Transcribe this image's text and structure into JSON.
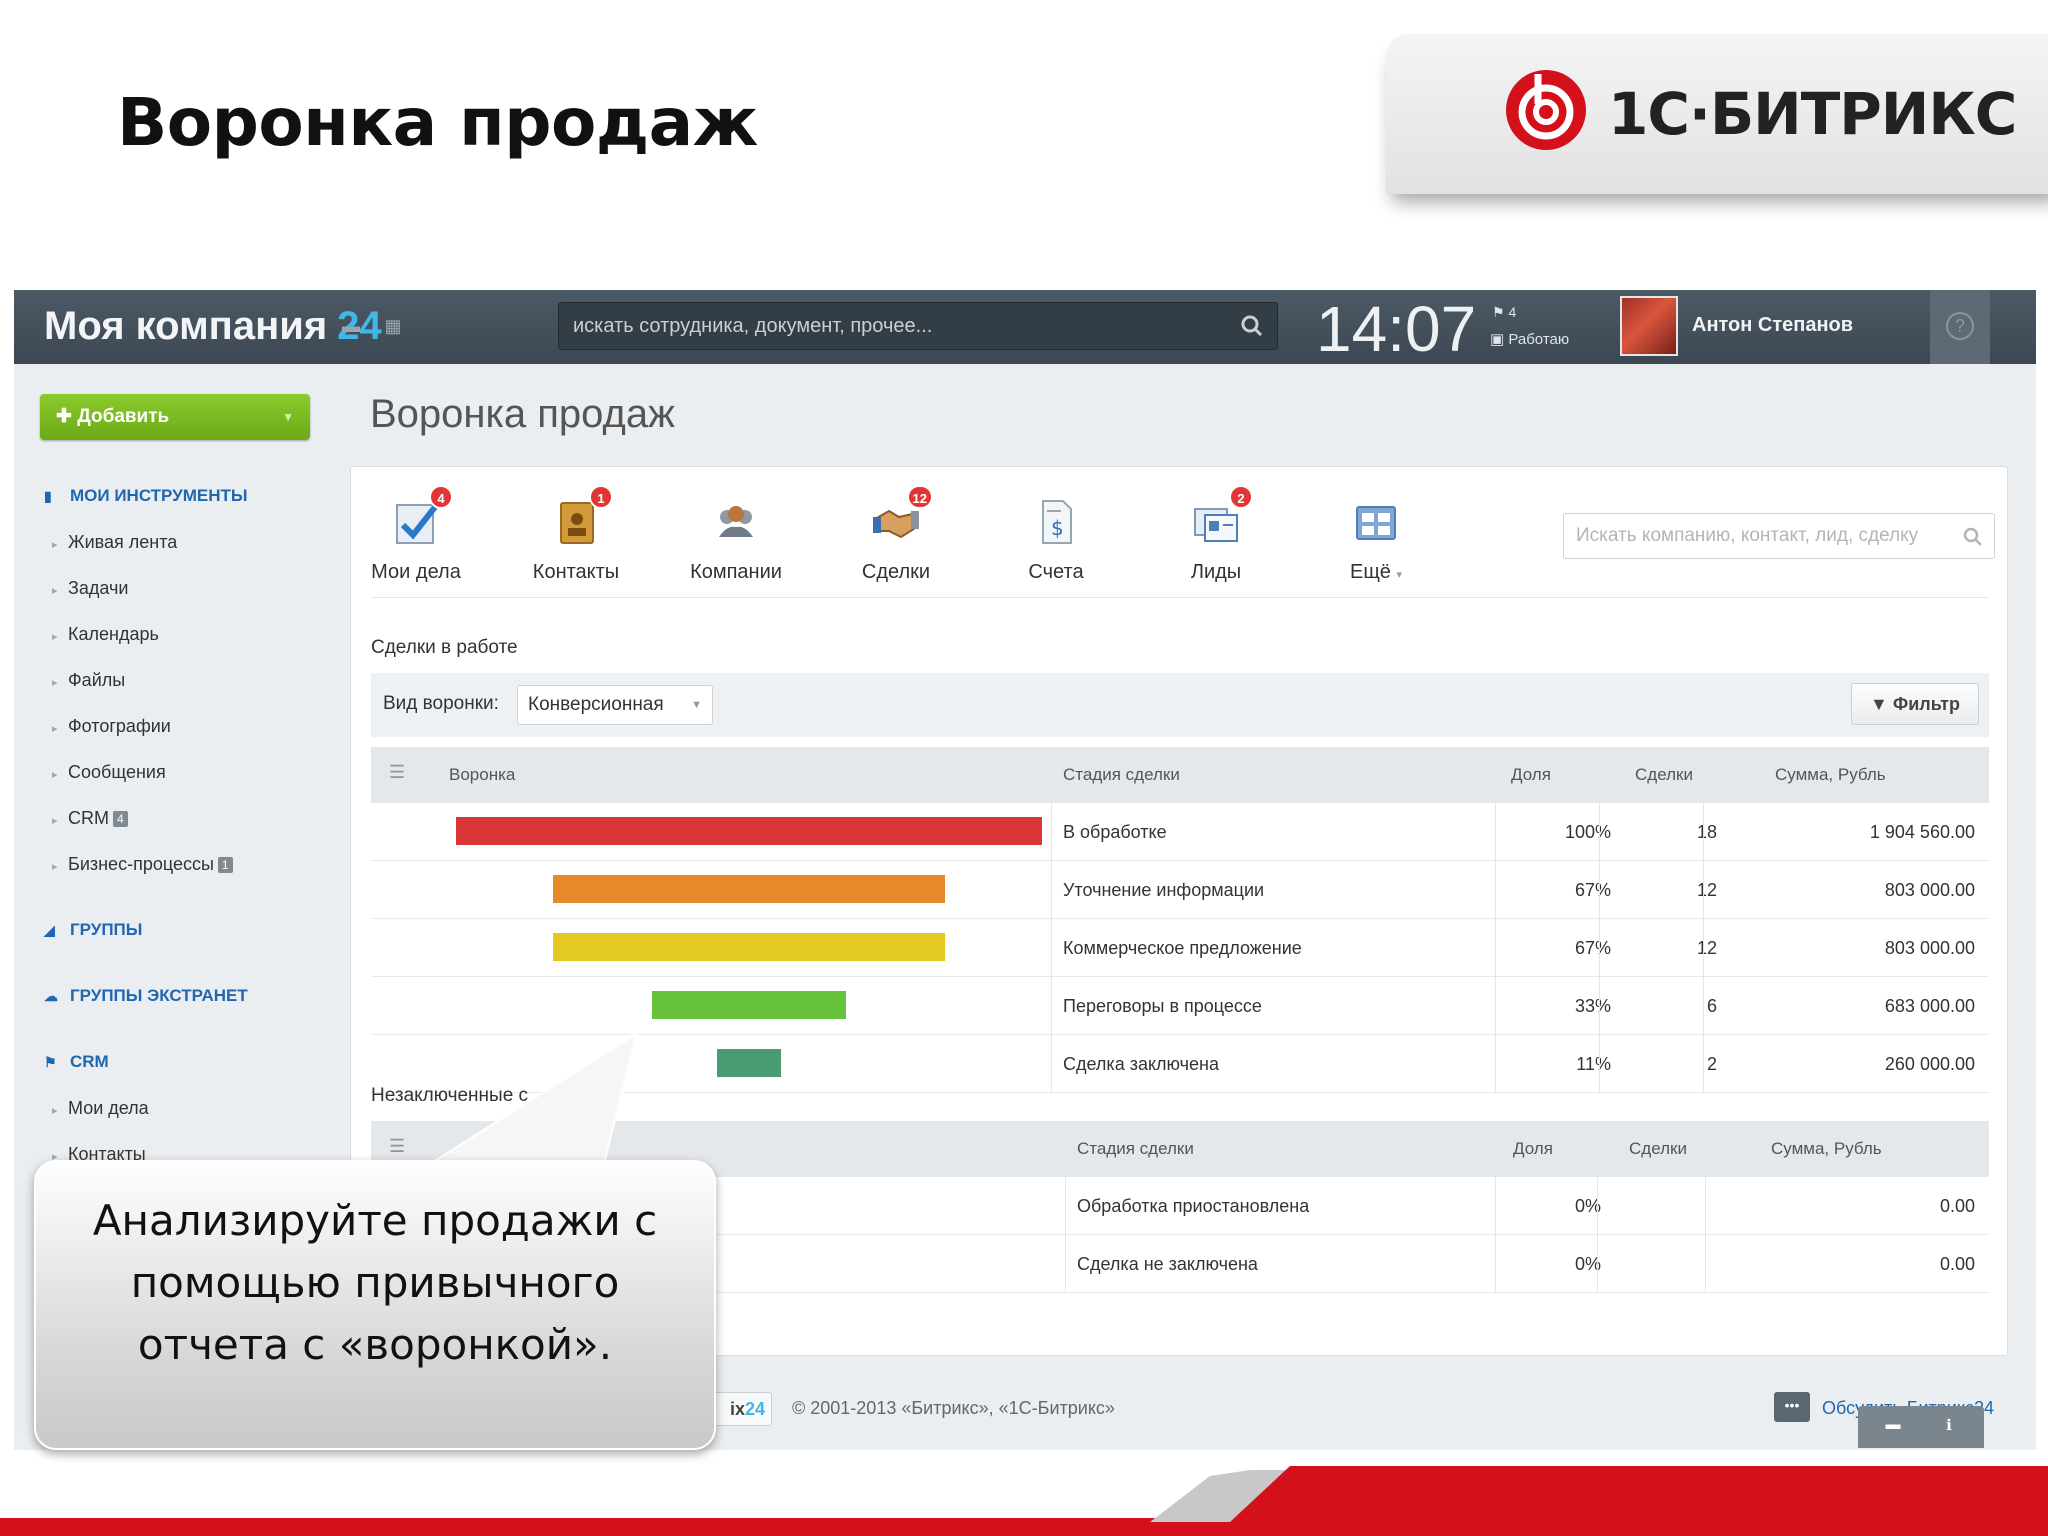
{
  "slide": {
    "title": "Воронка продаж",
    "logo_text": "1С·БИТРИКС"
  },
  "topbar": {
    "brand": "Моя компания",
    "brand_num": "24",
    "search_placeholder": "искать сотрудника, документ, прочее...",
    "clock": "14:07",
    "flag_count": "4",
    "status": "Работаю",
    "user_name": "Антон Степанов",
    "help": "?"
  },
  "sidebar": {
    "add_label": "Добавить",
    "my_tools": "МОИ ИНСТРУМЕНТЫ",
    "items": [
      {
        "label": "Живая лента"
      },
      {
        "label": "Задачи"
      },
      {
        "label": "Календарь"
      },
      {
        "label": "Файлы"
      },
      {
        "label": "Фотографии"
      },
      {
        "label": "Сообщения"
      },
      {
        "label": "CRM",
        "count": "4"
      },
      {
        "label": "Бизнес-процессы",
        "count": "1"
      }
    ],
    "groups": "ГРУППЫ",
    "extranet": "ГРУППЫ ЭКСТРАНЕТ",
    "crm": "CRM",
    "crm_items": [
      {
        "label": "Мои дела"
      },
      {
        "label": "Контакты"
      }
    ]
  },
  "main": {
    "page_title": "Воронка продаж",
    "tools": [
      {
        "label": "Мои дела",
        "badge": "4",
        "icon": "checklist-icon"
      },
      {
        "label": "Контакты",
        "badge": "1",
        "icon": "contacts-book-icon"
      },
      {
        "label": "Компании",
        "badge": "",
        "icon": "people-group-icon"
      },
      {
        "label": "Сделки",
        "badge": "12",
        "icon": "handshake-icon"
      },
      {
        "label": "Счета",
        "badge": "",
        "icon": "invoice-icon"
      },
      {
        "label": "Лиды",
        "badge": "2",
        "icon": "lead-cards-icon"
      },
      {
        "label": "Ещё",
        "badge": "",
        "icon": "more-grid-icon"
      }
    ],
    "crm_search_placeholder": "Искать компанию, контакт, лид, сделку",
    "in_work_label": "Сделки в работе",
    "funnel_type_label": "Вид воронки:",
    "funnel_type_value": "Конверсионная",
    "filter_label": "Фильтр",
    "columns": {
      "funnel": "Воронка",
      "stage": "Стадия сделки",
      "share": "Доля",
      "deals": "Сделки",
      "sum": "Сумма, Рубль"
    },
    "funnel_rows": [
      {
        "stage": "В обработке",
        "share": "100%",
        "deals": "18",
        "sum": "1 904 560.00",
        "color": "#d93636",
        "fraction": 1.0
      },
      {
        "stage": "Уточнение информации",
        "share": "67%",
        "deals": "12",
        "sum": "803 000.00",
        "color": "#e5892b",
        "fraction": 0.67
      },
      {
        "stage": "Коммерческое предложение",
        "share": "67%",
        "deals": "12",
        "sum": "803 000.00",
        "color": "#e5c923",
        "fraction": 0.67
      },
      {
        "stage": "Переговоры в процессе",
        "share": "33%",
        "deals": "6",
        "sum": "683 000.00",
        "color": "#66c23a",
        "fraction": 0.33
      },
      {
        "stage": "Сделка заключена",
        "share": "11%",
        "deals": "2",
        "sum": "260 000.00",
        "color": "#4a9a72",
        "fraction": 0.11
      }
    ],
    "lost_label": "Незаключенные с",
    "lost_rows": [
      {
        "stage": "Обработка приостановлена",
        "share": "0%",
        "deals": "",
        "sum": "0.00"
      },
      {
        "stage": "Сделка не заключена",
        "share": "0%",
        "deals": "",
        "sum": "0.00"
      }
    ]
  },
  "callout": {
    "line1": "Анализируйте продажи с",
    "line2": "помощью привычного",
    "line3": "отчета с «воронкой»."
  },
  "footer": {
    "logo_tail": "ix",
    "logo_num": "24",
    "copyright": "© 2001-2013 «Битрикс», «1С-Битрикс»",
    "discuss": "Обсудить Битрикс24"
  },
  "colors": {
    "accent_blue": "#2067b0",
    "brand_num": "#41b7e6",
    "add_green": "#7cbd22",
    "logo_red": "#d4111b"
  }
}
